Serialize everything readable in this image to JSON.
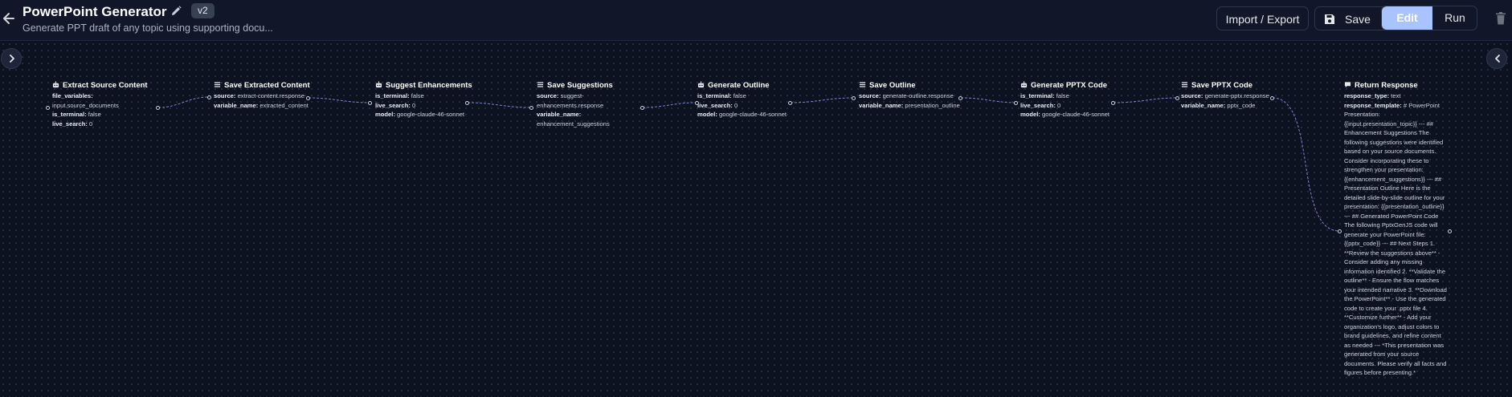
{
  "header": {
    "title": "PowerPoint Generator",
    "version": "v2",
    "subtitle": "Generate PPT draft of any topic using supporting docu...",
    "import_export_label": "Import / Export",
    "save_label": "Save",
    "edit_label": "Edit",
    "run_label": "Run"
  },
  "colors": {
    "background": "#0d1221",
    "header": "#111729",
    "edit_active": "#a9c3ff",
    "edge": "#7b86c9"
  },
  "icons": {
    "back": "arrow-left-icon",
    "edit_title": "pencil-icon",
    "save": "floppy-disk-icon",
    "delete": "trash-icon",
    "llm": "robot-icon",
    "variable": "list-icon",
    "response": "message-icon"
  },
  "nodes": [
    {
      "title": "Extract Source Content",
      "icon": "robot-icon",
      "fields": [
        {
          "key": "file_variables:",
          "value": ""
        },
        {
          "key": "",
          "value": "input.source_documents"
        },
        {
          "key": "is_terminal:",
          "value": "false"
        },
        {
          "key": "live_search:",
          "value": "0"
        }
      ]
    },
    {
      "title": "Save Extracted Content",
      "icon": "list-icon",
      "fields": [
        {
          "key": "source:",
          "value": "extract-content.response"
        },
        {
          "key": "variable_name:",
          "value": "extracted_content"
        }
      ]
    },
    {
      "title": "Suggest Enhancements",
      "icon": "robot-icon",
      "fields": [
        {
          "key": "is_terminal:",
          "value": "false"
        },
        {
          "key": "live_search:",
          "value": "0"
        },
        {
          "key": "model:",
          "value": "google-claude-46-sonnet"
        }
      ]
    },
    {
      "title": "Save Suggestions",
      "icon": "list-icon",
      "fields": [
        {
          "key": "source:",
          "value": "suggest-"
        },
        {
          "key": "",
          "value": "enhancements.response"
        },
        {
          "key": "variable_name:",
          "value": ""
        },
        {
          "key": "",
          "value": "enhancement_suggestions"
        }
      ]
    },
    {
      "title": "Generate Outline",
      "icon": "robot-icon",
      "fields": [
        {
          "key": "is_terminal:",
          "value": "false"
        },
        {
          "key": "live_search:",
          "value": "0"
        },
        {
          "key": "model:",
          "value": "google-claude-46-sonnet"
        }
      ]
    },
    {
      "title": "Save Outline",
      "icon": "list-icon",
      "fields": [
        {
          "key": "source:",
          "value": "generate-outline.response"
        },
        {
          "key": "variable_name:",
          "value": "presentation_outline"
        }
      ]
    },
    {
      "title": "Generate PPTX Code",
      "icon": "robot-icon",
      "fields": [
        {
          "key": "is_terminal:",
          "value": "false"
        },
        {
          "key": "live_search:",
          "value": "0"
        },
        {
          "key": "model:",
          "value": "google-claude-46-sonnet"
        }
      ]
    },
    {
      "title": "Save PPTX Code",
      "icon": "list-icon",
      "fields": [
        {
          "key": "source:",
          "value": "generate-pptx.response"
        },
        {
          "key": "variable_name:",
          "value": "pptx_code"
        }
      ]
    },
    {
      "title": "Return Response",
      "icon": "message-icon",
      "fields": [
        {
          "key": "response_type:",
          "value": "text"
        },
        {
          "key": "response_template:",
          "value": "# PowerPoint Presentation: {{input.presentation_topic}} --- ## Enhancement Suggestions The following suggestions were identified based on your source documents. Consider incorporating these to strengthen your presentation: {{enhancement_suggestions}} --- ## Presentation Outline Here is the detailed slide-by-slide outline for your presentation: {{presentation_outline}} --- ## Generated PowerPoint Code The following PptxGenJS code will generate your PowerPoint file: {{pptx_code}} --- ## Next Steps 1. **Review the suggestions above** - Consider adding any missing information identified 2. **Validate the outline** - Ensure the flow matches your intended narrative 3. **Download the PowerPoint** - Use the generated code to create your .pptx file 4. **Customize further** - Add your organization's logo, adjust colors to brand guidelines, and refine content as needed --- *This presentation was generated from your source documents. Please verify all facts and figures before presenting.*"
        }
      ]
    }
  ]
}
